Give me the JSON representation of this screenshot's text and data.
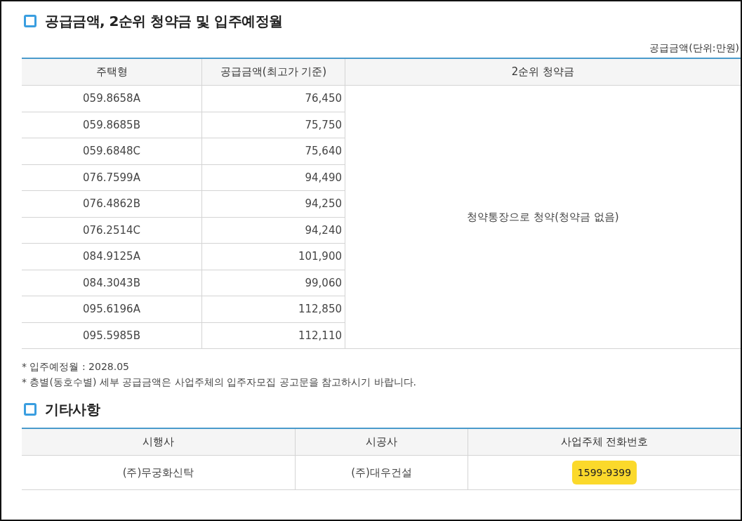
{
  "supply_section": {
    "title": "공급금액, 2순위 청약금 및 입주예정월",
    "unit_note": "공급금액(단위:만원)",
    "table": {
      "columns": [
        "주택형",
        "공급금액(최고가 기준)",
        "2순위 청약금"
      ],
      "rows": [
        {
          "type": "059.8658A",
          "price": "76,450"
        },
        {
          "type": "059.8685B",
          "price": "75,750"
        },
        {
          "type": "059.6848C",
          "price": "75,640"
        },
        {
          "type": "076.7599A",
          "price": "94,490"
        },
        {
          "type": "076.4862B",
          "price": "94,250"
        },
        {
          "type": "076.2514C",
          "price": "94,240"
        },
        {
          "type": "084.9125A",
          "price": "101,900"
        },
        {
          "type": "084.3043B",
          "price": "99,060"
        },
        {
          "type": "095.6196A",
          "price": "112,850"
        },
        {
          "type": "095.5985B",
          "price": "112,110"
        }
      ],
      "merged_cell": "청약통장으로 청약(청약금 없음)"
    },
    "notes": [
      "* 입주예정월 : 2028.05",
      "* 층별(동호수별) 세부 공급금액은 사업주체의 입주자모집 공고문을 참고하시기 바랍니다."
    ]
  },
  "other_section": {
    "title": "기타사항",
    "table": {
      "columns": [
        "시행사",
        "시공사",
        "사업주체 전화번호"
      ],
      "rows": [
        {
          "developer": "(주)무궁화신탁",
          "builder": "(주)대우건설",
          "phone": "1599-9399"
        }
      ]
    }
  }
}
